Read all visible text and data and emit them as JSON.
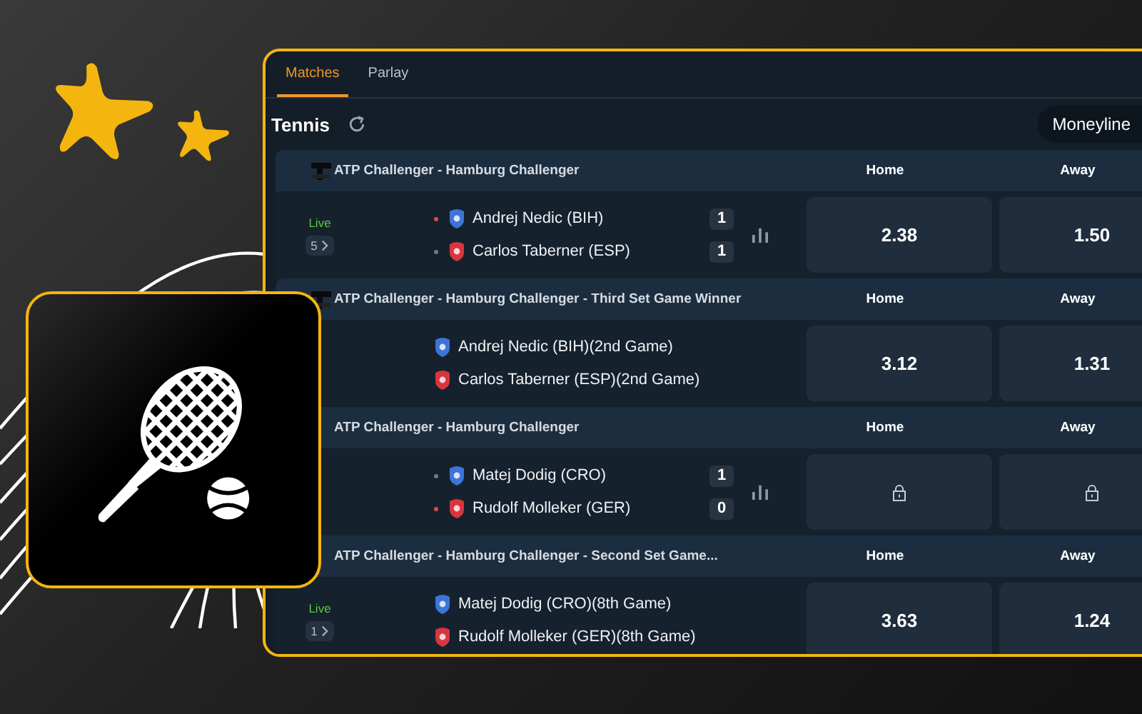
{
  "tabs": [
    {
      "label": "Matches",
      "selected": true
    },
    {
      "label": "Parlay",
      "selected": false
    }
  ],
  "sport": {
    "title": "Tennis"
  },
  "market_select": {
    "value": "Moneyline"
  },
  "events": [
    {
      "league": "ATP Challenger - Hamburg Challenger",
      "league_logo": true,
      "columns": [
        "Home",
        "Away"
      ],
      "live": "Live",
      "count": "5",
      "players": [
        {
          "name": "Andrej Nedic (BIH)",
          "color": "#3d74d8",
          "serving": true,
          "score": "1"
        },
        {
          "name": "Carlos Taberner (ESP)",
          "color": "#d8363e",
          "serving": false,
          "score": "1"
        }
      ],
      "stats": true,
      "odds": [
        {
          "kind": "price",
          "value": "2.38"
        },
        {
          "kind": "price",
          "value": "1.50"
        }
      ]
    },
    {
      "league": "ATP Challenger - Hamburg Challenger - Third Set Game Winner",
      "league_logo": true,
      "columns": [
        "Home",
        "Away"
      ],
      "players": [
        {
          "name": "Andrej Nedic (BIH)(2nd Game)",
          "color": "#3d74d8"
        },
        {
          "name": "Carlos Taberner (ESP)(2nd Game)",
          "color": "#d8363e"
        }
      ],
      "stats": false,
      "odds": [
        {
          "kind": "price",
          "value": "3.12"
        },
        {
          "kind": "price",
          "value": "1.31"
        }
      ]
    },
    {
      "league": "ATP Challenger - Hamburg Challenger",
      "league_logo": false,
      "columns": [
        "Home",
        "Away"
      ],
      "players": [
        {
          "name": "Matej Dodig (CRO)",
          "color": "#3d74d8",
          "serving": false,
          "score": "1"
        },
        {
          "name": "Rudolf Molleker (GER)",
          "color": "#d8363e",
          "serving": true,
          "score": "0"
        }
      ],
      "stats": true,
      "odds": [
        {
          "kind": "locked"
        },
        {
          "kind": "locked"
        }
      ]
    },
    {
      "league": "ATP Challenger - Hamburg Challenger - Second Set Game...",
      "league_logo": false,
      "columns": [
        "Home",
        "Away"
      ],
      "live": "Live",
      "count": "1",
      "players": [
        {
          "name": "Matej Dodig (CRO)(8th Game)",
          "color": "#3d74d8"
        },
        {
          "name": "Rudolf Molleker (GER)(8th Game)",
          "color": "#d8363e"
        }
      ],
      "stats": false,
      "odds": [
        {
          "kind": "price",
          "value": "3.63"
        },
        {
          "kind": "price",
          "value": "1.24"
        }
      ]
    }
  ]
}
